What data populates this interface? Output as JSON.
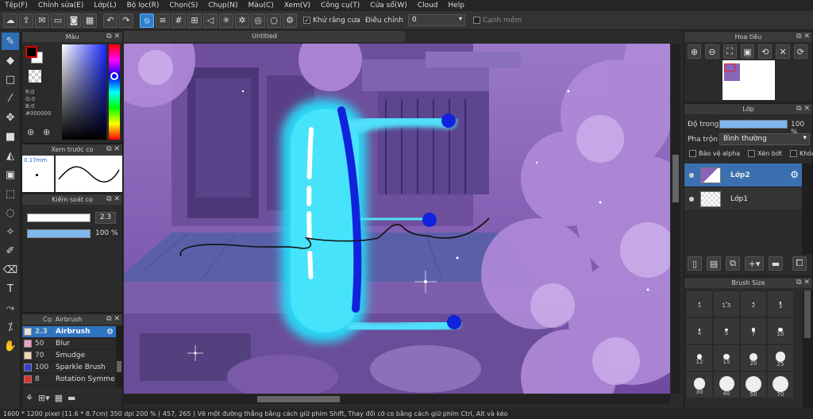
{
  "menu": [
    "Tệp(F)",
    "Chỉnh sửa(E)",
    "Lớp(L)",
    "Bộ lọc(R)",
    "Chọn(S)",
    "Chụp(N)",
    "Màu(C)",
    "Xem(V)",
    "Công cụ(T)",
    "Cửa sổ(W)",
    "Cloud",
    "Help"
  ],
  "toolbar": {
    "antialias_label": "Khử răng cưa",
    "adjust_label": "Điều chỉnh",
    "adjust_value": "0",
    "edge_label": "Cạnh mềm"
  },
  "panels": {
    "color_title": "Màu",
    "preview_title": "Xem trước cọ",
    "control_title": "Kiểm soát cọ",
    "brush_title": "Cọ: Airbrush",
    "navigator_title": "Hoa tiêu",
    "layer_title": "Lớp",
    "brushsize_title": "Brush Size"
  },
  "color": {
    "r": "R:0",
    "g": "G:0",
    "b": "B:0",
    "hex": "#000000",
    "primary": "#000000",
    "secondary": "#ffffff"
  },
  "preview": {
    "size": "0.17mm"
  },
  "control": {
    "size_value": "2.3",
    "opacity_value": "100 %"
  },
  "brushes": [
    {
      "num": "2.3",
      "name": "Airbrush",
      "color": "#e0e0e0",
      "selected": true
    },
    {
      "num": "50",
      "name": "Blur",
      "color": "#f0a0c8"
    },
    {
      "num": "70",
      "name": "Smudge",
      "color": "#f0d8b0"
    },
    {
      "num": "100",
      "name": "Sparkle Brush",
      "color": "#3040d0"
    },
    {
      "num": "8",
      "name": "Rotation Symme",
      "color": "#e03030"
    }
  ],
  "document": {
    "tab": "Untitled"
  },
  "layers": {
    "opacity_label": "Độ trong",
    "opacity_value": "100 %",
    "blend_label": "Pha trộn",
    "blend_value": "Bình thường",
    "protect_alpha": "Bảo vệ alpha",
    "clipping": "Xén bớt",
    "lock": "Khóa",
    "items": [
      {
        "name": "Lớp2",
        "selected": true
      },
      {
        "name": "Lớp1",
        "selected": false
      }
    ]
  },
  "brush_sizes": [
    "1",
    "1.5",
    "2",
    "3",
    "4",
    "5",
    "7",
    "10",
    "12",
    "15",
    "20",
    "25",
    "30",
    "40",
    "50",
    "70"
  ],
  "status": "1600 * 1200 pixel  (11.6 * 8.7cm)  350 dpi  200 %  ( 457, 265 )  Vẽ một đường thẳng bằng cách giữ phím Shift, Thay đổi cỡ cọ bằng cách giữ phím Ctrl, Alt và kéo"
}
